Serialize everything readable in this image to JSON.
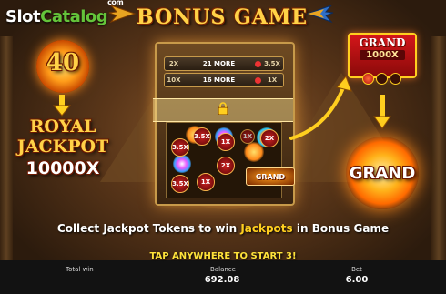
{
  "logo": {
    "part1": "Slot",
    "part2": "Catalog",
    "suffix": "com"
  },
  "title": "BONUS GAME",
  "left_panel": {
    "counter": "40",
    "royal_line1": "ROYAL",
    "royal_line2": "JACKPOT",
    "multiplier": "10000X"
  },
  "reel_rows": [
    {
      "left": "2X",
      "middle": "21 MORE",
      "right": "3.5X"
    },
    {
      "left": "10X",
      "middle": "16 MORE",
      "right": "1X"
    }
  ],
  "reel_chips": [
    "2X",
    "3.5X",
    "1X",
    "3.5X",
    "2X",
    "1X",
    "3.5X",
    "1X"
  ],
  "grand_tile_label": "GRAND",
  "grand_panel": {
    "title": "GRAND",
    "multiplier": "1000X"
  },
  "grand_orb_label": "GRAND",
  "info_text": {
    "before": "Collect Jackpot Tokens to win ",
    "highlight": "Jackpots",
    "after": " in Bonus Game"
  },
  "start_text": "TAP ANYWHERE TO START 3!",
  "footer": {
    "total_win_label": "Total win",
    "balance_label": "Balance",
    "balance_value": "692.08",
    "bet_label": "Bet",
    "bet_value": "6.00"
  },
  "colors": {
    "gold": "#ffd247",
    "accent_yellow": "#ffcf1f",
    "grand_red": "#c3140f",
    "bg_dark": "#2c1b0d"
  }
}
